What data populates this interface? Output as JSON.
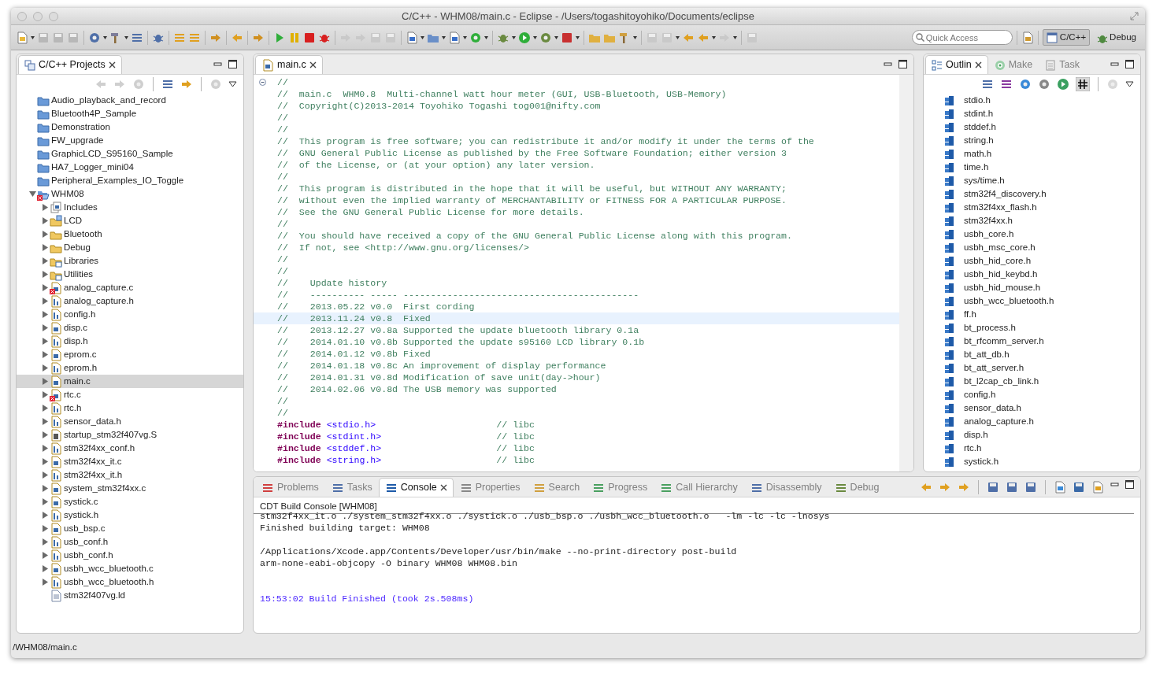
{
  "window": {
    "title": "C/C++ - WHM08/main.c - Eclipse - /Users/togashitoyohiko/Documents/eclipse"
  },
  "toolbar": {
    "quick_access": {
      "placeholder": "Quick Access"
    },
    "perspectives": [
      {
        "label": "C/C++",
        "selected": true
      },
      {
        "label": "Debug",
        "selected": false
      }
    ]
  },
  "project_explorer": {
    "tab": "C/C++ Projects",
    "items": [
      {
        "label": "Audio_playback_and_record",
        "kind": "project",
        "selected": false
      },
      {
        "label": "Bluetooth4P_Sample",
        "kind": "project",
        "selected": false
      },
      {
        "label": "Demonstration",
        "kind": "project",
        "selected": false
      },
      {
        "label": "FW_upgrade",
        "kind": "project",
        "selected": false
      },
      {
        "label": "GraphicLCD_S95160_Sample",
        "kind": "project",
        "selected": false
      },
      {
        "label": "HA7_Logger_mini04",
        "kind": "project",
        "selected": false
      },
      {
        "label": "Peripheral_Examples_IO_Toggle",
        "kind": "project",
        "selected": false
      },
      {
        "label": "WHM08",
        "kind": "open-project",
        "expanded": true,
        "error": true,
        "selected": false,
        "children": [
          {
            "label": "Includes",
            "kind": "includes",
            "expanded": false,
            "selected": false
          },
          {
            "label": "LCD",
            "kind": "source-folder",
            "expanded": false,
            "selected": false
          },
          {
            "label": "Bluetooth",
            "kind": "folder",
            "expanded": false,
            "selected": false
          },
          {
            "label": "Debug",
            "kind": "folder",
            "expanded": false,
            "selected": false
          },
          {
            "label": "Libraries",
            "kind": "library-folder",
            "expanded": false,
            "selected": false
          },
          {
            "label": "Utilities",
            "kind": "library-folder",
            "expanded": false,
            "selected": false
          },
          {
            "label": "analog_capture.c",
            "kind": "c",
            "expanded": false,
            "error": true,
            "selected": false
          },
          {
            "label": "analog_capture.h",
            "kind": "h",
            "expanded": false,
            "selected": false
          },
          {
            "label": "config.h",
            "kind": "h",
            "expanded": false,
            "selected": false
          },
          {
            "label": "disp.c",
            "kind": "c",
            "expanded": false,
            "selected": false
          },
          {
            "label": "disp.h",
            "kind": "h",
            "expanded": false,
            "selected": false
          },
          {
            "label": "eprom.c",
            "kind": "c",
            "expanded": false,
            "selected": false
          },
          {
            "label": "eprom.h",
            "kind": "h",
            "expanded": false,
            "selected": false
          },
          {
            "label": "main.c",
            "kind": "c",
            "expanded": false,
            "selected": true
          },
          {
            "label": "rtc.c",
            "kind": "c",
            "expanded": false,
            "error": true,
            "selected": false
          },
          {
            "label": "rtc.h",
            "kind": "h",
            "expanded": false,
            "selected": false
          },
          {
            "label": "sensor_data.h",
            "kind": "h",
            "expanded": false,
            "selected": false
          },
          {
            "label": "startup_stm32f407vg.S",
            "kind": "asm",
            "expanded": false,
            "selected": false
          },
          {
            "label": "stm32f4xx_conf.h",
            "kind": "h",
            "expanded": false,
            "selected": false
          },
          {
            "label": "stm32f4xx_it.c",
            "kind": "c",
            "expanded": false,
            "selected": false
          },
          {
            "label": "stm32f4xx_it.h",
            "kind": "h",
            "expanded": false,
            "selected": false
          },
          {
            "label": "system_stm32f4xx.c",
            "kind": "c",
            "expanded": false,
            "selected": false
          },
          {
            "label": "systick.c",
            "kind": "c",
            "expanded": false,
            "selected": false
          },
          {
            "label": "systick.h",
            "kind": "h",
            "expanded": false,
            "selected": false
          },
          {
            "label": "usb_bsp.c",
            "kind": "c",
            "expanded": false,
            "selected": false
          },
          {
            "label": "usb_conf.h",
            "kind": "h",
            "expanded": false,
            "selected": false
          },
          {
            "label": "usbh_conf.h",
            "kind": "h",
            "expanded": false,
            "selected": false
          },
          {
            "label": "usbh_wcc_bluetooth.c",
            "kind": "c",
            "expanded": false,
            "selected": false
          },
          {
            "label": "usbh_wcc_bluetooth.h",
            "kind": "h",
            "expanded": false,
            "selected": false
          },
          {
            "label": "stm32f407vg.ld",
            "kind": "text",
            "selected": false
          }
        ]
      }
    ]
  },
  "editor": {
    "tab": "main.c",
    "lines": [
      {
        "fold_open": true,
        "highlighted": false,
        "segments": [
          {
            "kind": "comment",
            "text": "//"
          }
        ]
      },
      {
        "highlighted": false,
        "segments": [
          {
            "kind": "comment",
            "text": "//  main.c  WHM0.8  Multi-channel watt hour meter (GUI, USB-Bluetooth, USB-Memory)"
          }
        ]
      },
      {
        "highlighted": false,
        "segments": [
          {
            "kind": "comment",
            "text": "//  Copyright(C)2013-2014 Toyohiko Togashi tog001@nifty.com"
          }
        ]
      },
      {
        "highlighted": false,
        "segments": [
          {
            "kind": "comment",
            "text": "//"
          }
        ]
      },
      {
        "highlighted": false,
        "segments": [
          {
            "kind": "comment",
            "text": "//"
          }
        ]
      },
      {
        "highlighted": false,
        "segments": [
          {
            "kind": "comment",
            "text": "//  This program is free software; you can redistribute it and/or modify it under the terms of the"
          }
        ]
      },
      {
        "highlighted": false,
        "segments": [
          {
            "kind": "comment",
            "text": "//  GNU General Public License as published by the Free Software Foundation; either version 3"
          }
        ]
      },
      {
        "highlighted": false,
        "segments": [
          {
            "kind": "comment",
            "text": "//  of the License, or (at your option) any later version."
          }
        ]
      },
      {
        "highlighted": false,
        "segments": [
          {
            "kind": "comment",
            "text": "//"
          }
        ]
      },
      {
        "highlighted": false,
        "segments": [
          {
            "kind": "comment",
            "text": "//  This program is distributed in the hope that it will be useful, but WITHOUT ANY WARRANTY;"
          }
        ]
      },
      {
        "highlighted": false,
        "segments": [
          {
            "kind": "comment",
            "text": "//  without even the implied warranty of MERCHANTABILITY or FITNESS FOR A PARTICULAR PURPOSE."
          }
        ]
      },
      {
        "highlighted": false,
        "segments": [
          {
            "kind": "comment",
            "text": "//  See the GNU General Public License for more details."
          }
        ]
      },
      {
        "highlighted": false,
        "segments": [
          {
            "kind": "comment",
            "text": "//"
          }
        ]
      },
      {
        "highlighted": false,
        "segments": [
          {
            "kind": "comment",
            "text": "//  You should have received a copy of the GNU General Public License along with this program."
          }
        ]
      },
      {
        "highlighted": false,
        "segments": [
          {
            "kind": "comment",
            "text": "//  If not, see <http://www.gnu.org/licenses/>"
          }
        ]
      },
      {
        "highlighted": false,
        "segments": [
          {
            "kind": "comment",
            "text": "//"
          }
        ]
      },
      {
        "highlighted": false,
        "segments": [
          {
            "kind": "comment",
            "text": "//"
          }
        ]
      },
      {
        "highlighted": false,
        "segments": [
          {
            "kind": "comment",
            "text": "//    Update history"
          }
        ]
      },
      {
        "highlighted": false,
        "segments": [
          {
            "kind": "comment",
            "text": "//    ---------- ----- -------------------------------------------"
          }
        ]
      },
      {
        "highlighted": false,
        "segments": [
          {
            "kind": "comment",
            "text": "//    2013.05.22 v0.0  First cording"
          }
        ]
      },
      {
        "highlighted": true,
        "segments": [
          {
            "kind": "comment",
            "text": "//    2013.11.24 v0.8  Fixed"
          }
        ]
      },
      {
        "highlighted": false,
        "segments": [
          {
            "kind": "comment",
            "text": "//    2013.12.27 v0.8a Supported the update bluetooth library 0.1a"
          }
        ]
      },
      {
        "highlighted": false,
        "segments": [
          {
            "kind": "comment",
            "text": "//    2014.01.10 v0.8b Supported the update s95160 LCD library 0.1b"
          }
        ]
      },
      {
        "highlighted": false,
        "segments": [
          {
            "kind": "comment",
            "text": "//    2014.01.12 v0.8b Fixed"
          }
        ]
      },
      {
        "highlighted": false,
        "segments": [
          {
            "kind": "comment",
            "text": "//    2014.01.18 v0.8c An improvement of display performance"
          }
        ]
      },
      {
        "highlighted": false,
        "segments": [
          {
            "kind": "comment",
            "text": "//    2014.01.31 v0.8d Modification of save unit(day->hour)"
          }
        ]
      },
      {
        "highlighted": false,
        "segments": [
          {
            "kind": "comment",
            "text": "//    2014.02.06 v0.8d The USB memory was supported"
          }
        ]
      },
      {
        "highlighted": false,
        "segments": [
          {
            "kind": "comment",
            "text": "//"
          }
        ]
      },
      {
        "highlighted": false,
        "segments": [
          {
            "kind": "comment",
            "text": "//"
          }
        ]
      },
      {
        "highlighted": false,
        "segments": [
          {
            "kind": "directive",
            "text": "#include"
          },
          {
            "kind": "header",
            "text": "<stdio.h>"
          },
          {
            "kind": "trailing-comment",
            "text": "// libc"
          }
        ]
      },
      {
        "highlighted": false,
        "segments": [
          {
            "kind": "directive",
            "text": "#include"
          },
          {
            "kind": "header",
            "text": "<stdint.h>"
          },
          {
            "kind": "trailing-comment",
            "text": "// libc"
          }
        ]
      },
      {
        "highlighted": false,
        "segments": [
          {
            "kind": "directive",
            "text": "#include"
          },
          {
            "kind": "header",
            "text": "<stddef.h>"
          },
          {
            "kind": "trailing-comment",
            "text": "// libc"
          }
        ]
      },
      {
        "highlighted": false,
        "segments": [
          {
            "kind": "directive",
            "text": "#include"
          },
          {
            "kind": "header",
            "text": "<string.h>"
          },
          {
            "kind": "trailing-comment",
            "text": "// libc"
          }
        ]
      }
    ]
  },
  "outline": {
    "tabs": [
      {
        "label": "Outlin",
        "selected": true
      },
      {
        "label": "Make",
        "selected": false
      },
      {
        "label": "Task",
        "selected": false
      }
    ],
    "items": [
      "stdio.h",
      "stdint.h",
      "stddef.h",
      "string.h",
      "math.h",
      "time.h",
      "sys/time.h",
      "stm32f4_discovery.h",
      "stm32f4xx_flash.h",
      "stm32f4xx.h",
      "usbh_core.h",
      "usbh_msc_core.h",
      "usbh_hid_core.h",
      "usbh_hid_keybd.h",
      "usbh_hid_mouse.h",
      "usbh_wcc_bluetooth.h",
      "ff.h",
      "bt_process.h",
      "bt_rfcomm_server.h",
      "bt_att_db.h",
      "bt_att_server.h",
      "bt_l2cap_cb_link.h",
      "config.h",
      "sensor_data.h",
      "analog_capture.h",
      "disp.h",
      "rtc.h",
      "systick.h"
    ]
  },
  "console": {
    "tabs": [
      {
        "label": "Problems",
        "selected": false
      },
      {
        "label": "Tasks",
        "selected": false
      },
      {
        "label": "Console",
        "selected": true
      },
      {
        "label": "Properties",
        "selected": false
      },
      {
        "label": "Search",
        "selected": false
      },
      {
        "label": "Progress",
        "selected": false
      },
      {
        "label": "Call Hierarchy",
        "selected": false
      },
      {
        "label": "Disassembly",
        "selected": false
      },
      {
        "label": "Debug",
        "selected": false
      }
    ],
    "title": "CDT Build Console [WHM08]",
    "lines": [
      {
        "kind": "output",
        "gap_before": false,
        "text": "stm32f4xx_it.o ./system_stm32f4xx.o ./systick.o ./usb_bsp.o ./usbh_wcc_bluetooth.o   -lm -lc -lc -lnosys"
      },
      {
        "kind": "output",
        "gap_before": false,
        "text": "Finished building target: WHM08"
      },
      {
        "kind": "output",
        "gap_before": true,
        "text": "/Applications/Xcode.app/Contents/Developer/usr/bin/make --no-print-directory post-build"
      },
      {
        "kind": "output",
        "gap_before": false,
        "text": "arm-none-eabi-objcopy -O binary WHM08 WHM08.bin"
      },
      {
        "kind": "info",
        "gap_before": true,
        "text": "15:53:02 Build Finished (took 2s.508ms)"
      }
    ]
  },
  "status_bar": {
    "path": "/WHM08/main.c"
  }
}
